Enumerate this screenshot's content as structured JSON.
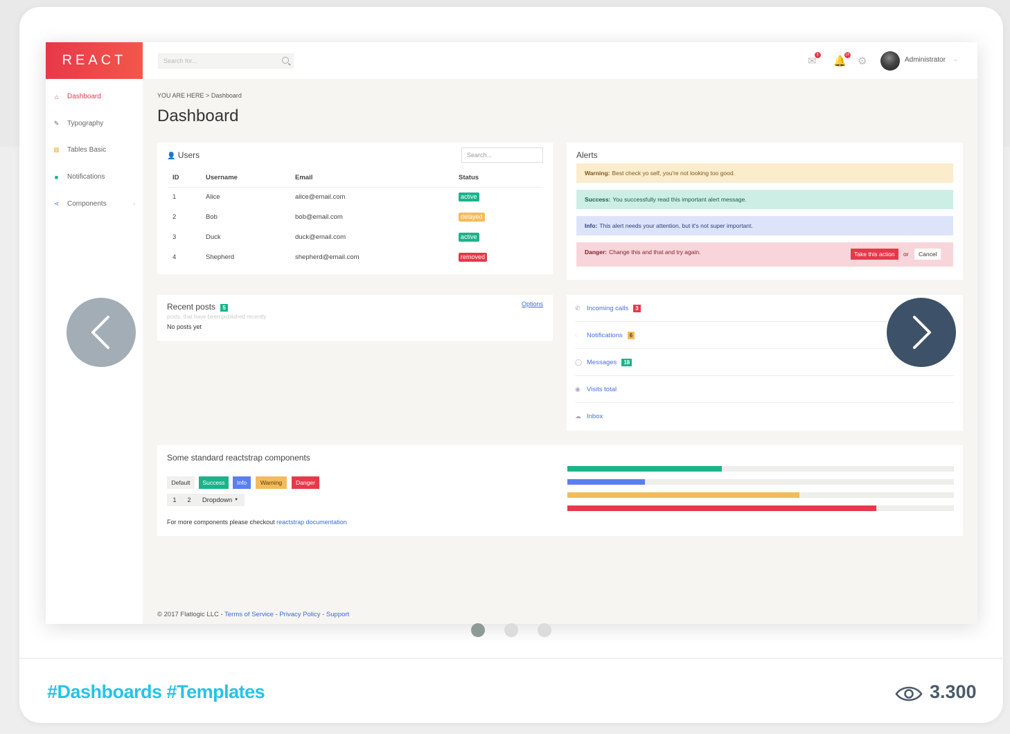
{
  "app": {
    "logo_text": "REACT",
    "search_placeholder": "Search for...",
    "user_name": "Administrator",
    "notif_badges": [
      "3",
      "13"
    ],
    "accent": "#e8384a"
  },
  "sidebar": {
    "items": [
      {
        "label": "Dashboard",
        "icon": "home-icon",
        "active": true
      },
      {
        "label": "Typography",
        "icon": "edit-icon",
        "active": false
      },
      {
        "label": "Tables Basic",
        "icon": "table-icon",
        "active": false
      },
      {
        "label": "Notifications",
        "icon": "chat-icon",
        "active": false
      },
      {
        "label": "Components",
        "icon": "share-icon",
        "active": false
      }
    ]
  },
  "breadcrumb": {
    "prefix": "YOU ARE HERE",
    "sep": ">",
    "current": "Dashboard"
  },
  "page_title": "Dashboard",
  "users": {
    "title": "Users",
    "search_placeholder": "Search...",
    "columns": [
      "ID",
      "Username",
      "Email",
      "Status"
    ],
    "rows": [
      {
        "id": "1",
        "username": "Alice",
        "email": "alice@email.com",
        "status": "active",
        "color": "#1bb38a"
      },
      {
        "id": "2",
        "username": "Bob",
        "email": "bob@email.com",
        "status": "delayed",
        "color": "#f3bb5a"
      },
      {
        "id": "3",
        "username": "Duck",
        "email": "duck@email.com",
        "status": "active",
        "color": "#1bb38a"
      },
      {
        "id": "4",
        "username": "Shepherd",
        "email": "shepherd@email.com",
        "status": "removed",
        "color": "#e8384a"
      }
    ]
  },
  "alerts": {
    "title": "Alerts",
    "items": [
      {
        "strong": "Warning:",
        "text": "Best check yo self, you're not looking too good.",
        "bg": "#fbeccc",
        "color": "#7a5a20"
      },
      {
        "strong": "Success:",
        "text": "You successfully read this important alert message.",
        "bg": "#cdeee4",
        "color": "#1d5a48"
      },
      {
        "strong": "Info:",
        "text": "This alert needs your attention, but it's not super important.",
        "bg": "#dde4fa",
        "color": "#2a3f7a"
      },
      {
        "strong": "Danger:",
        "text": "Change this and that and try again.",
        "bg": "#f8d5da",
        "color": "#7a1f28"
      }
    ],
    "action_label": "Take this action",
    "or_label": "or",
    "cancel_label": "Cancel"
  },
  "recent_posts": {
    "title": "Recent posts",
    "count": "5",
    "subtitle": "posts, that have been published recently",
    "empty": "No posts yet",
    "options": "Options"
  },
  "links": [
    {
      "label": "Incoming calls",
      "icon": "phone-icon",
      "count": "3",
      "count_bg": "#e8384a"
    },
    {
      "label": "Notifications",
      "icon": "bell-icon",
      "count": "6",
      "count_bg": "#f3bb5a"
    },
    {
      "label": "Messages",
      "icon": "comment-icon",
      "count": "18",
      "count_bg": "#1bb38a"
    },
    {
      "label": "Visits total",
      "icon": "eye-icon",
      "count": "",
      "count_bg": ""
    },
    {
      "label": "Inbox",
      "icon": "cloud-icon",
      "count": "",
      "count_bg": ""
    }
  ],
  "components": {
    "title": "Some standard reactstrap components",
    "buttons": [
      {
        "label": "Default",
        "bg": "#f0f0ee",
        "color": "#333"
      },
      {
        "label": "Success",
        "bg": "#1bb38a",
        "color": "#fff"
      },
      {
        "label": "Info",
        "bg": "#5b7ff0",
        "color": "#fff"
      },
      {
        "label": "Warning",
        "bg": "#f3bb5a",
        "color": "#5a3f10"
      },
      {
        "label": "Danger",
        "bg": "#e8384a",
        "color": "#fff"
      }
    ],
    "pager": [
      "1",
      "2"
    ],
    "dropdown_label": "Dropdown",
    "more_text": "For more components please checkout",
    "more_link": "reactstrap documentation",
    "progress": [
      {
        "value": 40,
        "color": "#1bb38a"
      },
      {
        "value": 20,
        "color": "#5b7ff0"
      },
      {
        "value": 60,
        "color": "#f3bb5a"
      },
      {
        "value": 80,
        "color": "#e8384a"
      }
    ]
  },
  "footer": {
    "copyright": "© 2017 Flatlogic LLC",
    "links": [
      "Terms of Service",
      "Privacy Policy",
      "Support"
    ]
  },
  "card": {
    "tags": "#Dashboards #Templates",
    "views": "3.300",
    "dots_active_index": 0
  }
}
